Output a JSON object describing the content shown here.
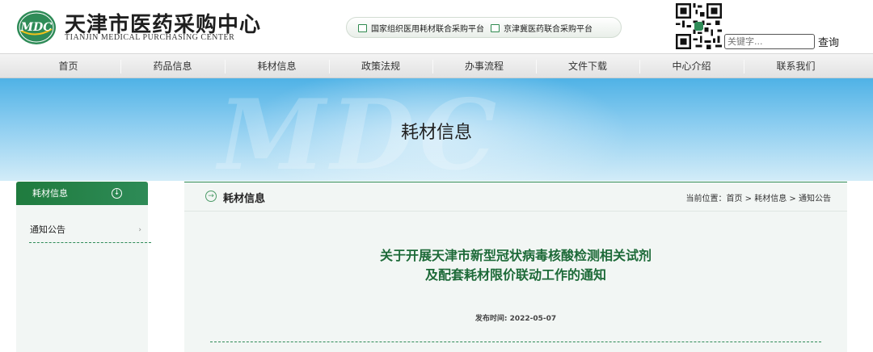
{
  "header": {
    "logo_text": "MDC",
    "logo_cn": "天津市医药采购中心",
    "logo_en": "TIANJIN MEDICAL PURCHASING CENTER",
    "platform_links": [
      {
        "label": "国家组织医用耗材联合采购平台"
      },
      {
        "label": "京津冀医药联合采购平台"
      }
    ],
    "search": {
      "placeholder": "关键字...",
      "button": "查询"
    }
  },
  "nav": {
    "items": [
      {
        "label": "首页"
      },
      {
        "label": "药品信息"
      },
      {
        "label": "耗材信息"
      },
      {
        "label": "政策法规"
      },
      {
        "label": "办事流程"
      },
      {
        "label": "文件下载"
      },
      {
        "label": "中心介绍"
      },
      {
        "label": "联系我们"
      }
    ]
  },
  "banner": {
    "title": "耗材信息",
    "watermark": "MDC"
  },
  "sidebar": {
    "header": "耗材信息",
    "items": [
      {
        "label": "通知公告"
      }
    ]
  },
  "main": {
    "section_title": "耗材信息",
    "breadcrumb": {
      "prefix": "当前位置：",
      "items": [
        "首页",
        "耗材信息",
        "通知公告"
      ],
      "separator": " > "
    },
    "article": {
      "title_line1": "关于开展天津市新型冠状病毒核酸检测相关试剂",
      "title_line2": "及配套耗材限价联动工作的通知",
      "date_label": "发布时间: ",
      "date_value": "2022-05-07"
    }
  },
  "colors": {
    "brand_green": "#2e8b57",
    "title_green": "#1d6a38",
    "banner_blue": "#4fb2e6"
  }
}
